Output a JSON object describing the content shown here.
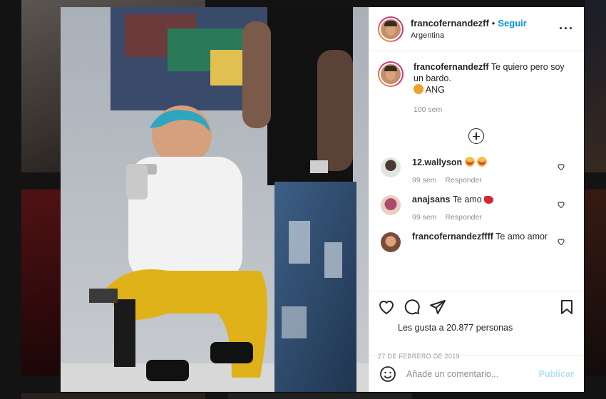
{
  "post": {
    "username": "francofernandezff",
    "follow_label": "Seguir",
    "location": "Argentina",
    "more_icon": "more-options-icon",
    "caption": {
      "username": "francofernandezff",
      "text_line1": "Te quiero pero soy",
      "text_line2": "un bardo.",
      "text_line3": "ANG",
      "time": "100 sem"
    },
    "load_more_icon": "plus-circle-icon",
    "comments": [
      {
        "username": "12.wallyson",
        "text": "",
        "time": "99 sem",
        "reply": "Responder",
        "emoji": "heart-eyes-emoji x2"
      },
      {
        "username": "anajsans",
        "text": "Te amo",
        "time": "99 sem",
        "reply": "Responder",
        "emoji": "heart-emoji"
      },
      {
        "username": "francofernandezffff",
        "text": "Te amo amor",
        "time": "",
        "reply": ""
      }
    ],
    "likes_text": "Les gusta a 20.877 personas",
    "date": "27 DE FEBRERO DE 2019",
    "add_comment_placeholder": "Añade un comentario...",
    "publish_label": "Publicar"
  },
  "colors": {
    "accent": "#0095f6",
    "publish_disabled": "#b2dffc",
    "muted": "#8e8e8e",
    "text": "#262626"
  }
}
